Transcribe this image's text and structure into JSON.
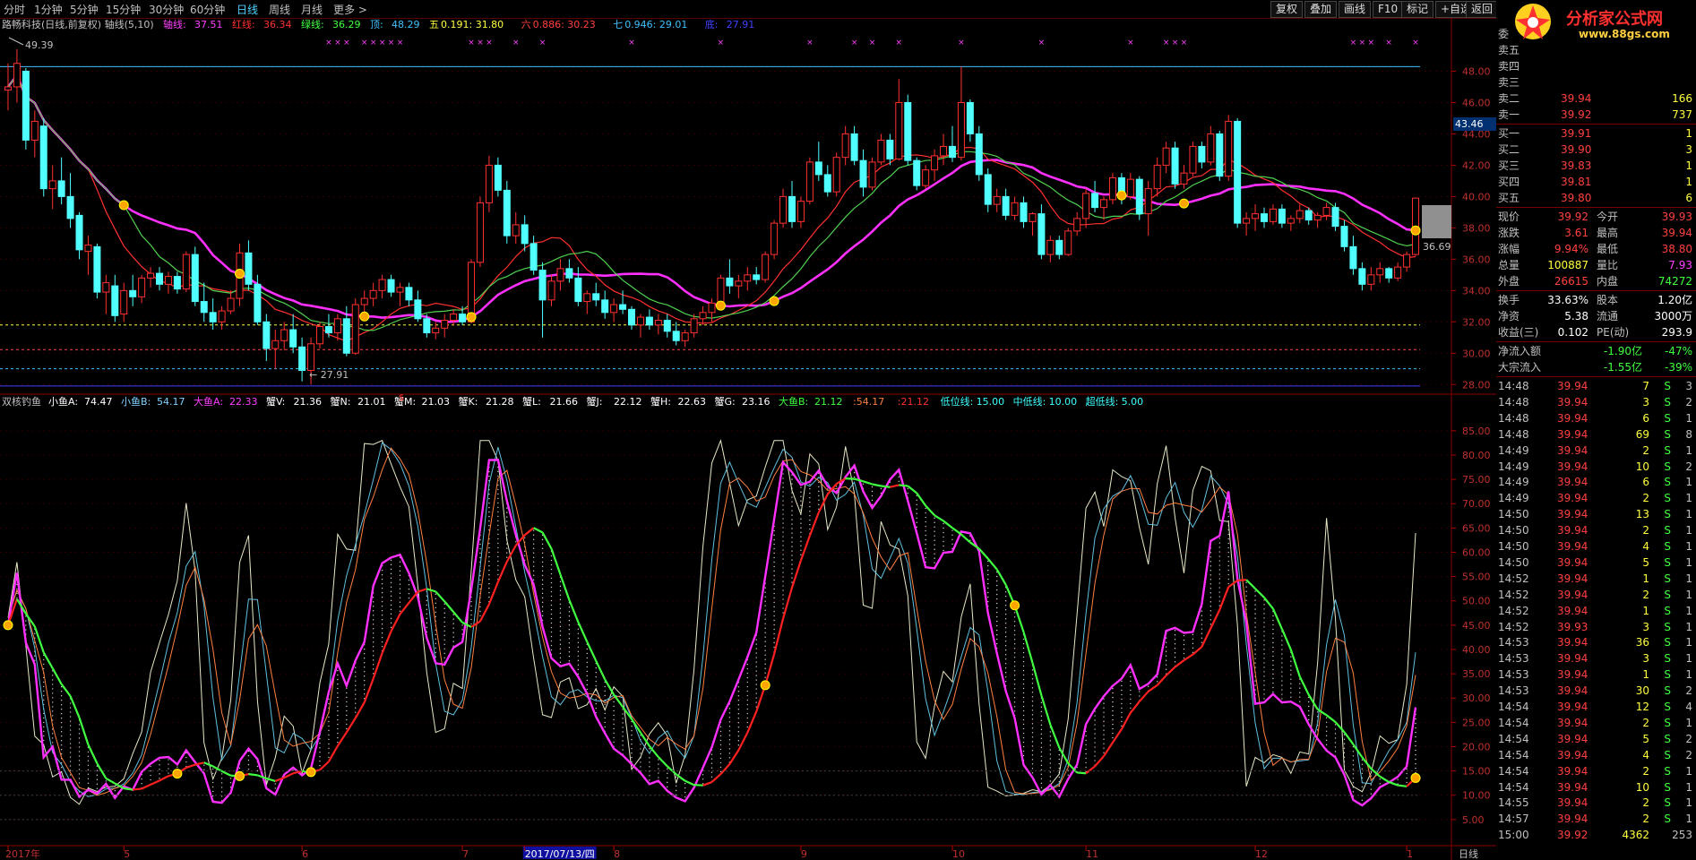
{
  "toolbar": {
    "periods": [
      "分时",
      "1分钟",
      "5分钟",
      "15分钟",
      "30分钟",
      "60分钟",
      "日线",
      "周线",
      "月线",
      "更多 >"
    ],
    "active_period": "日线",
    "right_buttons": [
      "复权",
      "叠加",
      "画线",
      "F10",
      "标记",
      "+自选",
      "返回"
    ]
  },
  "logo": {
    "title": "分析家公式网",
    "url": "www.88gs.com"
  },
  "main_chart": {
    "header": {
      "title": "路畅科技(日线,前复权) 轴线(5,10)",
      "indicators": [
        {
          "label": "轴线:",
          "value": "37.51",
          "color": "#ff40ff"
        },
        {
          "label": "红线:",
          "value": "36.34",
          "color": "#ff3030"
        },
        {
          "label": "绿线:",
          "value": "36.29",
          "color": "#40ff40"
        },
        {
          "label": "顶:",
          "value": "48.29",
          "color": "#40c0ff"
        },
        {
          "label": "五",
          "value": "0.191: 31.80",
          "color": "#ffff40"
        },
        {
          "label": "六",
          "value": "0.886: 30.23",
          "color": "#ff4040"
        },
        {
          "label": "七",
          "value": "0.946: 29.01",
          "color": "#40c0ff"
        },
        {
          "label": "底:",
          "value": "27.91",
          "color": "#4040ff"
        }
      ]
    },
    "high_label": "49.39",
    "low_label": "27.91",
    "last_price_tag": "43.46",
    "ma_label": "36.69",
    "y_ticks": [
      "48.00",
      "46.00",
      "44.00",
      "42.00",
      "40.00",
      "38.00",
      "36.00",
      "34.00",
      "32.00",
      "30.00",
      "28.00"
    ],
    "ylim": [
      27.5,
      49.8
    ],
    "hlines": [
      {
        "value": 48.29,
        "color": "#40c0ff"
      },
      {
        "value": 31.8,
        "color": "#ffff40",
        "dash": true
      },
      {
        "value": 30.23,
        "color": "#ff4040",
        "dash": true
      },
      {
        "value": 29.01,
        "color": "#40c0ff",
        "dash": true
      },
      {
        "value": 27.91,
        "color": "#4040ff"
      }
    ]
  },
  "sub_chart": {
    "header": {
      "title": "双核钓鱼",
      "indicators": [
        {
          "label": "小鱼A:",
          "value": "74.47",
          "color": "#ffffff"
        },
        {
          "label": "小鱼B:",
          "value": "54.17",
          "color": "#80d0ff"
        },
        {
          "label": "大鱼A:",
          "value": "22.33",
          "color": "#ff40ff"
        },
        {
          "label": "蟹V:",
          "value": "21.36",
          "color": "#ffffff"
        },
        {
          "label": "蟹N:",
          "value": "21.01",
          "color": "#ffffff"
        },
        {
          "label": "蟹M:",
          "value": "21.03",
          "color": "#ffffff"
        },
        {
          "label": "蟹K:",
          "value": "21.28",
          "color": "#ffffff"
        },
        {
          "label": "蟹L:",
          "value": "21.66",
          "color": "#ffffff"
        },
        {
          "label": "蟹J:",
          "value": "22.12",
          "color": "#ffffff"
        },
        {
          "label": "蟹H:",
          "value": "22.63",
          "color": "#ffffff"
        },
        {
          "label": "蟹G:",
          "value": "23.16",
          "color": "#ffffff"
        },
        {
          "label": "大鱼B:",
          "value": "21.12",
          "color": "#40ff40"
        },
        {
          "label": "",
          "value": ":54.17",
          "color": "#ff8040"
        },
        {
          "label": "",
          "value": ":21.12",
          "color": "#ff3030"
        },
        {
          "label": "低位线:",
          "value": "15.00",
          "color": "#40ffff"
        },
        {
          "label": "中低线:",
          "value": "10.00",
          "color": "#40ffff"
        },
        {
          "label": "超低线:",
          "value": "5.00",
          "color": "#40ffff"
        }
      ]
    },
    "y_ticks": [
      "85.00",
      "80.00",
      "75.00",
      "70.00",
      "65.00",
      "60.00",
      "55.00",
      "50.00",
      "45.00",
      "40.00",
      "35.00",
      "30.00",
      "25.00",
      "20.00",
      "15.00",
      "10.00",
      "5.00"
    ],
    "ylim": [
      0,
      87
    ]
  },
  "x_axis": {
    "labels": [
      {
        "text": "2017年",
        "i": 0
      },
      {
        "text": "5",
        "i": 13
      },
      {
        "text": "6",
        "i": 33
      },
      {
        "text": "7",
        "i": 51
      },
      {
        "text": "2017/07/13/四",
        "i": 58,
        "highlight": true
      },
      {
        "text": "8",
        "i": 68
      },
      {
        "text": "9",
        "i": 89
      },
      {
        "text": "10",
        "i": 106
      },
      {
        "text": "11",
        "i": 121
      },
      {
        "text": "12",
        "i": 140
      },
      {
        "text": "1",
        "i": 157
      }
    ],
    "corner": "日线"
  },
  "right_panel": {
    "header": "委",
    "asks": [
      {
        "label": "卖五",
        "price": "",
        "vol": ""
      },
      {
        "label": "卖四",
        "price": "",
        "vol": ""
      },
      {
        "label": "卖三",
        "price": "",
        "vol": ""
      },
      {
        "label": "卖二",
        "price": "39.94",
        "vol": "166"
      },
      {
        "label": "卖一",
        "price": "39.92",
        "vol": "737"
      }
    ],
    "bids": [
      {
        "label": "买一",
        "price": "39.91",
        "vol": "1"
      },
      {
        "label": "买二",
        "price": "39.90",
        "vol": "3"
      },
      {
        "label": "买三",
        "price": "39.83",
        "vol": "1"
      },
      {
        "label": "买四",
        "price": "39.81",
        "vol": "1"
      },
      {
        "label": "买五",
        "price": "39.80",
        "vol": "6"
      }
    ],
    "stats": [
      [
        {
          "k": "现价",
          "v": "39.92",
          "c": "#ff4040"
        },
        {
          "k": "今开",
          "v": "39.93",
          "c": "#ff4040"
        }
      ],
      [
        {
          "k": "涨跌",
          "v": "3.61",
          "c": "#ff4040"
        },
        {
          "k": "最高",
          "v": "39.94",
          "c": "#ff4040"
        }
      ],
      [
        {
          "k": "涨幅",
          "v": "9.94%",
          "c": "#ff4040"
        },
        {
          "k": "最低",
          "v": "38.80",
          "c": "#ff4040"
        }
      ],
      [
        {
          "k": "总量",
          "v": "100887",
          "c": "#ffff40"
        },
        {
          "k": "量比",
          "v": "7.93",
          "c": "#ff40ff"
        }
      ],
      [
        {
          "k": "外盘",
          "v": "26615",
          "c": "#ff4040"
        },
        {
          "k": "内盘",
          "v": "74272",
          "c": "#40ff40"
        }
      ]
    ],
    "stats2": [
      [
        {
          "k": "换手",
          "v": "33.63%",
          "c": "#ffffff"
        },
        {
          "k": "股本",
          "v": "1.20亿",
          "c": "#ffffff"
        }
      ],
      [
        {
          "k": "净资",
          "v": "5.38",
          "c": "#ffffff"
        },
        {
          "k": "流通",
          "v": "3000万",
          "c": "#ffffff"
        }
      ],
      [
        {
          "k": "收益(三)",
          "v": "0.102",
          "c": "#ffffff"
        },
        {
          "k": "PE(动)",
          "v": "293.9",
          "c": "#ffffff"
        }
      ]
    ],
    "flows": [
      {
        "k": "净流入额",
        "v": "-1.90亿",
        "p": "-47%"
      },
      {
        "k": "大宗流入",
        "v": "-1.55亿",
        "p": "-39%"
      }
    ],
    "ticks": [
      [
        "14:48",
        "39.94",
        "7",
        "S",
        "3"
      ],
      [
        "14:48",
        "39.94",
        "3",
        "S",
        "2"
      ],
      [
        "14:48",
        "39.94",
        "6",
        "S",
        "1"
      ],
      [
        "14:48",
        "39.94",
        "69",
        "S",
        "8"
      ],
      [
        "14:49",
        "39.94",
        "2",
        "S",
        "1"
      ],
      [
        "14:49",
        "39.94",
        "10",
        "S",
        "2"
      ],
      [
        "14:49",
        "39.94",
        "6",
        "S",
        "1"
      ],
      [
        "14:49",
        "39.94",
        "2",
        "S",
        "1"
      ],
      [
        "14:50",
        "39.94",
        "13",
        "S",
        "1"
      ],
      [
        "14:50",
        "39.94",
        "2",
        "S",
        "1"
      ],
      [
        "14:50",
        "39.94",
        "4",
        "S",
        "1"
      ],
      [
        "14:50",
        "39.94",
        "5",
        "S",
        "1"
      ],
      [
        "14:52",
        "39.94",
        "1",
        "S",
        "1"
      ],
      [
        "14:52",
        "39.94",
        "2",
        "S",
        "1"
      ],
      [
        "14:52",
        "39.94",
        "1",
        "S",
        "1"
      ],
      [
        "14:52",
        "39.93",
        "3",
        "S",
        "1"
      ],
      [
        "14:53",
        "39.94",
        "36",
        "S",
        "1"
      ],
      [
        "14:53",
        "39.94",
        "3",
        "S",
        "1"
      ],
      [
        "14:53",
        "39.94",
        "1",
        "S",
        "1"
      ],
      [
        "14:53",
        "39.94",
        "30",
        "S",
        "2"
      ],
      [
        "14:54",
        "39.94",
        "12",
        "S",
        "4"
      ],
      [
        "14:54",
        "39.94",
        "2",
        "S",
        "1"
      ],
      [
        "14:54",
        "39.94",
        "5",
        "S",
        "2"
      ],
      [
        "14:54",
        "39.94",
        "4",
        "S",
        "2"
      ],
      [
        "14:54",
        "39.94",
        "2",
        "S",
        "1"
      ],
      [
        "14:54",
        "39.94",
        "10",
        "S",
        "1"
      ],
      [
        "14:55",
        "39.94",
        "2",
        "S",
        "1"
      ],
      [
        "14:57",
        "39.94",
        "2",
        "S",
        "1"
      ],
      [
        "15:00",
        "39.92",
        "4362",
        "",
        ""
      ]
    ],
    "footer_extra": "253"
  },
  "candles": [
    [
      46.8,
      48.5,
      45.5,
      47.0
    ],
    [
      47.0,
      49.4,
      46.0,
      48.5
    ],
    [
      48.0,
      48.2,
      43.0,
      43.6
    ],
    [
      43.6,
      45.5,
      42.5,
      44.8
    ],
    [
      44.5,
      45.0,
      40.0,
      40.5
    ],
    [
      40.5,
      42.0,
      39.2,
      41.0
    ],
    [
      41.0,
      42.5,
      39.5,
      40.0
    ],
    [
      40.0,
      41.5,
      38.0,
      38.6
    ],
    [
      38.8,
      39.0,
      36.0,
      36.6
    ],
    [
      36.5,
      37.5,
      35.0,
      36.9
    ],
    [
      36.8,
      37.0,
      33.5,
      33.9
    ],
    [
      33.9,
      35.0,
      32.5,
      34.5
    ],
    [
      34.3,
      35.0,
      32.0,
      32.4
    ],
    [
      32.5,
      34.5,
      32.0,
      34.0
    ],
    [
      34.0,
      35.0,
      33.0,
      33.6
    ],
    [
      33.6,
      35.0,
      33.2,
      34.8
    ],
    [
      34.8,
      35.5,
      34.2,
      35.1
    ],
    [
      35.1,
      35.5,
      34.0,
      34.4
    ],
    [
      34.4,
      35.2,
      33.8,
      34.9
    ],
    [
      34.9,
      35.2,
      33.8,
      34.1
    ],
    [
      34.1,
      36.5,
      33.9,
      36.3
    ],
    [
      36.3,
      36.8,
      33.0,
      33.3
    ],
    [
      33.3,
      34.5,
      32.0,
      32.6
    ],
    [
      32.6,
      33.5,
      31.5,
      32.0
    ],
    [
      32.0,
      33.0,
      31.5,
      32.7
    ],
    [
      32.7,
      34.0,
      32.5,
      33.5
    ],
    [
      33.5,
      37.0,
      33.0,
      36.4
    ],
    [
      36.4,
      37.2,
      34.0,
      34.4
    ],
    [
      34.4,
      35.0,
      31.8,
      32.0
    ],
    [
      32.0,
      32.5,
      29.5,
      30.3
    ],
    [
      30.3,
      31.5,
      29.0,
      30.8
    ],
    [
      30.8,
      32.0,
      30.2,
      31.5
    ],
    [
      31.5,
      32.5,
      30.0,
      30.4
    ],
    [
      30.4,
      31.0,
      28.2,
      28.9
    ],
    [
      28.9,
      31.0,
      28.0,
      30.6
    ],
    [
      30.6,
      32.0,
      30.3,
      31.7
    ],
    [
      31.7,
      32.5,
      31.0,
      31.3
    ],
    [
      31.3,
      32.5,
      30.8,
      32.2
    ],
    [
      32.2,
      33.0,
      29.8,
      30.0
    ],
    [
      30.0,
      33.5,
      29.9,
      33.1
    ],
    [
      33.1,
      34.0,
      32.6,
      33.5
    ],
    [
      33.5,
      34.5,
      33.0,
      34.0
    ],
    [
      34.0,
      35.0,
      33.5,
      34.7
    ],
    [
      34.7,
      35.0,
      33.6,
      33.9
    ],
    [
      33.9,
      34.5,
      33.0,
      34.2
    ],
    [
      34.2,
      34.5,
      33.0,
      33.4
    ],
    [
      33.4,
      34.0,
      32.0,
      32.2
    ],
    [
      32.2,
      32.5,
      31.0,
      31.3
    ],
    [
      31.3,
      32.0,
      30.9,
      31.6
    ],
    [
      31.6,
      32.5,
      31.0,
      32.1
    ],
    [
      32.1,
      32.8,
      31.8,
      32.5
    ],
    [
      32.5,
      33.0,
      31.8,
      32.0
    ],
    [
      32.0,
      36.0,
      31.9,
      35.8
    ],
    [
      35.8,
      40.0,
      35.5,
      39.6
    ],
    [
      39.6,
      42.6,
      39.0,
      42.0
    ],
    [
      42.0,
      42.5,
      40.0,
      40.4
    ],
    [
      40.4,
      41.0,
      37.0,
      37.5
    ],
    [
      37.5,
      39.0,
      37.0,
      38.2
    ],
    [
      38.2,
      38.8,
      36.5,
      37.0
    ],
    [
      37.0,
      37.5,
      35.0,
      35.3
    ],
    [
      35.3,
      35.8,
      31.0,
      33.4
    ],
    [
      33.4,
      35.0,
      33.0,
      34.6
    ],
    [
      34.6,
      36.0,
      34.0,
      35.4
    ],
    [
      35.4,
      36.0,
      34.5,
      34.8
    ],
    [
      34.8,
      35.5,
      33.0,
      33.3
    ],
    [
      33.3,
      34.0,
      32.5,
      33.8
    ],
    [
      33.8,
      34.5,
      33.0,
      33.4
    ],
    [
      33.4,
      34.0,
      32.2,
      32.6
    ],
    [
      32.6,
      33.5,
      32.0,
      33.1
    ],
    [
      33.1,
      34.0,
      32.5,
      32.8
    ],
    [
      32.8,
      33.0,
      31.5,
      31.8
    ],
    [
      31.8,
      32.5,
      31.0,
      32.3
    ],
    [
      32.3,
      32.8,
      31.5,
      31.8
    ],
    [
      31.8,
      32.5,
      31.2,
      32.1
    ],
    [
      32.1,
      32.5,
      31.0,
      31.4
    ],
    [
      31.4,
      32.0,
      30.5,
      30.8
    ],
    [
      30.8,
      31.5,
      30.4,
      31.3
    ],
    [
      31.3,
      32.5,
      31.0,
      32.2
    ],
    [
      32.2,
      33.0,
      31.8,
      32.6
    ],
    [
      32.6,
      33.5,
      32.0,
      33.2
    ],
    [
      33.2,
      35.0,
      33.0,
      34.8
    ],
    [
      34.8,
      36.0,
      33.8,
      34.3
    ],
    [
      34.3,
      35.0,
      33.5,
      34.6
    ],
    [
      34.6,
      35.5,
      34.0,
      35.0
    ],
    [
      35.0,
      35.5,
      34.4,
      34.7
    ],
    [
      34.7,
      36.5,
      34.5,
      36.3
    ],
    [
      36.3,
      38.5,
      36.0,
      38.3
    ],
    [
      38.3,
      40.5,
      38.0,
      40.0
    ],
    [
      40.0,
      41.0,
      38.0,
      38.4
    ],
    [
      38.4,
      40.0,
      38.0,
      39.7
    ],
    [
      39.7,
      42.5,
      39.5,
      42.2
    ],
    [
      42.2,
      43.5,
      41.0,
      41.4
    ],
    [
      41.4,
      42.0,
      40.0,
      40.3
    ],
    [
      40.3,
      42.8,
      40.0,
      42.5
    ],
    [
      42.5,
      44.5,
      42.0,
      44.0
    ],
    [
      44.0,
      44.5,
      42.0,
      42.3
    ],
    [
      42.3,
      43.0,
      40.0,
      40.6
    ],
    [
      40.6,
      42.5,
      40.4,
      42.2
    ],
    [
      42.2,
      44.0,
      42.0,
      43.6
    ],
    [
      43.6,
      44.0,
      42.0,
      42.4
    ],
    [
      42.4,
      47.5,
      42.3,
      46.0
    ],
    [
      46.0,
      46.5,
      42.0,
      42.3
    ],
    [
      42.3,
      42.5,
      40.4,
      40.7
    ],
    [
      40.7,
      42.0,
      40.5,
      41.7
    ],
    [
      41.7,
      43.0,
      41.0,
      42.6
    ],
    [
      42.6,
      44.0,
      42.0,
      43.2
    ],
    [
      43.2,
      44.5,
      42.2,
      42.5
    ],
    [
      42.5,
      48.3,
      42.3,
      46.0
    ],
    [
      46.0,
      46.2,
      43.5,
      44.0
    ],
    [
      44.0,
      44.5,
      41.0,
      41.4
    ],
    [
      41.4,
      41.8,
      39.0,
      39.5
    ],
    [
      39.5,
      40.5,
      39.0,
      40.0
    ],
    [
      40.0,
      40.5,
      38.5,
      38.8
    ],
    [
      38.8,
      40.0,
      38.5,
      39.6
    ],
    [
      39.6,
      40.0,
      38.0,
      38.4
    ],
    [
      38.4,
      39.0,
      37.5,
      38.9
    ],
    [
      38.9,
      39.5,
      36.0,
      36.3
    ],
    [
      36.3,
      37.5,
      35.8,
      37.2
    ],
    [
      37.2,
      37.5,
      36.0,
      36.3
    ],
    [
      36.3,
      38.0,
      36.2,
      37.8
    ],
    [
      37.8,
      39.0,
      37.5,
      38.6
    ],
    [
      38.6,
      40.5,
      38.0,
      40.2
    ],
    [
      40.2,
      41.0,
      39.0,
      39.3
    ],
    [
      39.3,
      40.0,
      38.5,
      39.8
    ],
    [
      39.8,
      41.5,
      39.5,
      41.2
    ],
    [
      41.2,
      41.5,
      39.5,
      40.0
    ],
    [
      40.0,
      41.5,
      39.8,
      41.1
    ],
    [
      41.1,
      41.3,
      38.5,
      38.9
    ],
    [
      38.9,
      41.0,
      37.5,
      40.5
    ],
    [
      40.5,
      42.5,
      40.0,
      42.0
    ],
    [
      42.0,
      43.5,
      41.5,
      43.1
    ],
    [
      43.1,
      43.5,
      40.5,
      40.8
    ],
    [
      40.8,
      42.0,
      40.5,
      41.5
    ],
    [
      41.5,
      43.5,
      41.3,
      43.2
    ],
    [
      43.2,
      43.5,
      41.8,
      42.2
    ],
    [
      42.2,
      44.5,
      42.0,
      44.0
    ],
    [
      44.0,
      44.2,
      41.0,
      41.3
    ],
    [
      41.3,
      45.2,
      41.0,
      44.8
    ],
    [
      44.8,
      45.0,
      38.0,
      38.3
    ],
    [
      38.3,
      39.0,
      37.5,
      38.6
    ],
    [
      38.6,
      39.5,
      37.8,
      38.9
    ],
    [
      38.9,
      39.3,
      38.0,
      38.4
    ],
    [
      38.4,
      39.5,
      38.2,
      39.2
    ],
    [
      39.2,
      39.5,
      38.0,
      38.3
    ],
    [
      38.3,
      38.8,
      37.8,
      38.6
    ],
    [
      38.6,
      39.5,
      38.3,
      39.1
    ],
    [
      39.1,
      39.3,
      38.2,
      38.5
    ],
    [
      38.5,
      39.0,
      38.0,
      38.8
    ],
    [
      38.8,
      39.6,
      38.5,
      39.3
    ],
    [
      39.3,
      39.6,
      37.8,
      38.1
    ],
    [
      38.1,
      38.5,
      36.5,
      36.8
    ],
    [
      36.8,
      37.5,
      35.0,
      35.4
    ],
    [
      35.4,
      35.8,
      34.0,
      34.4
    ],
    [
      34.4,
      35.5,
      34.0,
      35.0
    ],
    [
      35.0,
      35.8,
      34.5,
      35.4
    ],
    [
      35.4,
      35.5,
      34.5,
      34.8
    ],
    [
      34.8,
      35.8,
      34.6,
      35.5
    ],
    [
      35.5,
      36.5,
      35.2,
      36.3
    ],
    [
      36.3,
      39.9,
      36.2,
      39.9
    ]
  ]
}
